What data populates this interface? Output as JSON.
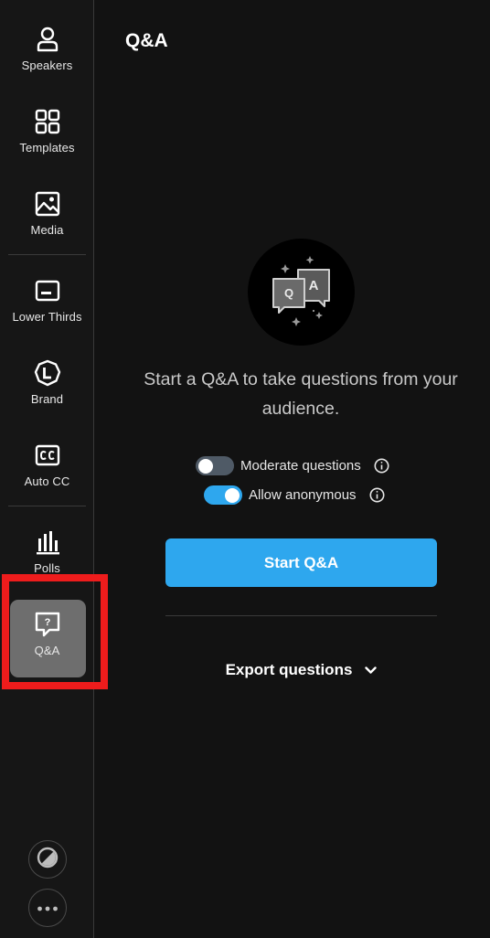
{
  "sidebar": {
    "items": [
      {
        "label": "Speakers",
        "icon": "person-icon"
      },
      {
        "label": "Templates",
        "icon": "grid-icon"
      },
      {
        "label": "Media",
        "icon": "image-icon"
      },
      {
        "label": "Lower Thirds",
        "icon": "lower-thirds-icon"
      },
      {
        "label": "Brand",
        "icon": "brand-icon"
      },
      {
        "label": "Auto CC",
        "icon": "cc-icon"
      },
      {
        "label": "Polls",
        "icon": "bar-chart-icon"
      },
      {
        "label": "Q&A",
        "icon": "question-bubble-icon",
        "active": true
      }
    ],
    "bottom_buttons": [
      "theme-contrast-icon",
      "more-dots-icon"
    ]
  },
  "main": {
    "title": "Q&A",
    "hero_icon": "qa-speech-bubbles-icon",
    "hero_letters": {
      "q": "Q",
      "a": "A"
    },
    "prompt": "Start a Q&A to take questions from your audience.",
    "toggles": [
      {
        "label": "Moderate questions",
        "on": false
      },
      {
        "label": "Allow anonymous",
        "on": true
      }
    ],
    "start_button": "Start Q&A",
    "export_label": "Export questions"
  },
  "colors": {
    "accent": "#2ea7ee",
    "background": "#121212",
    "sidebar": "#161616",
    "active_item": "#6e6e6e",
    "highlight": "#ee1c1c"
  }
}
